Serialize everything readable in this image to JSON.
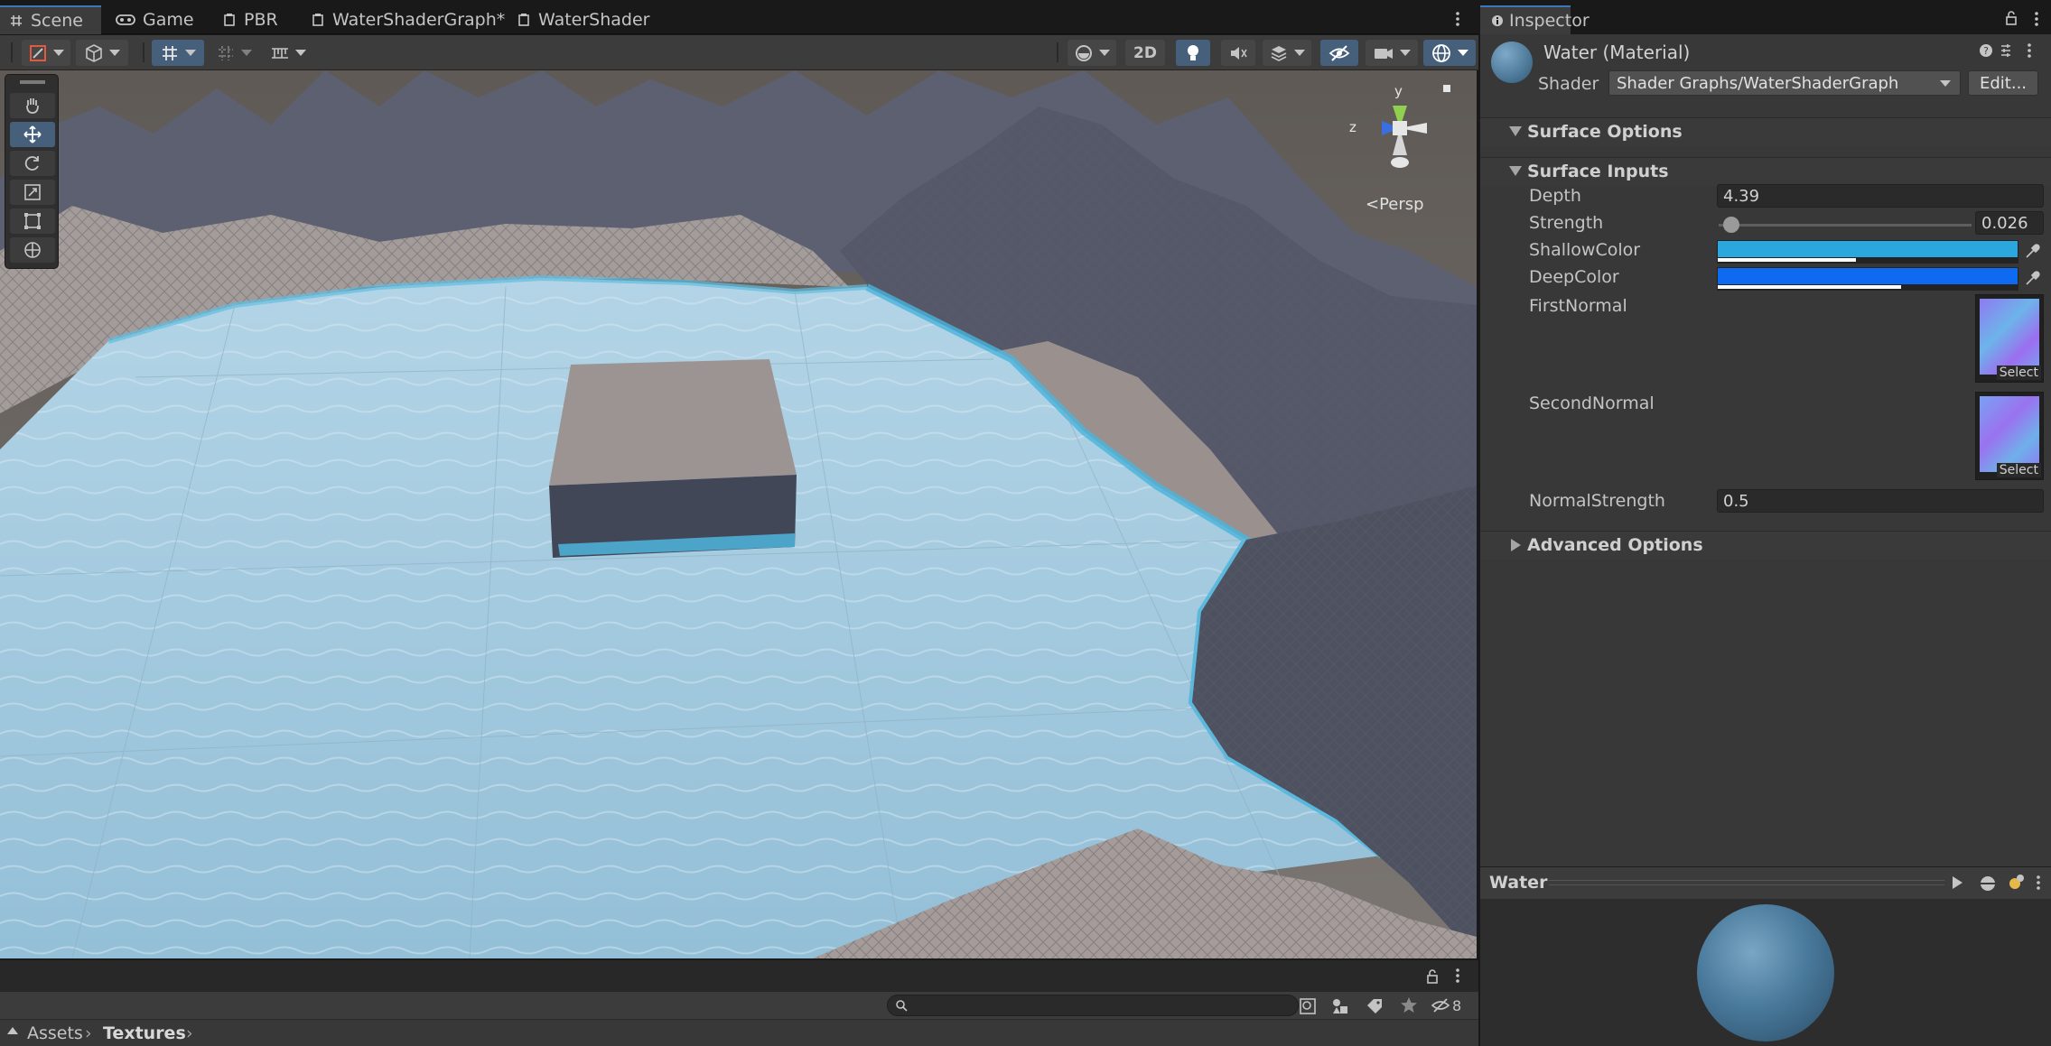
{
  "scene_tabs": [
    {
      "label": "Scene",
      "icon": "grid-icon",
      "active": true
    },
    {
      "label": "Game",
      "icon": "gamepad-icon",
      "active": false
    },
    {
      "label": "PBR",
      "icon": "shadergraph-icon",
      "active": false
    },
    {
      "label": "WaterShaderGraph*",
      "icon": "shadergraph-icon",
      "active": false
    },
    {
      "label": "WaterShader",
      "icon": "shadergraph-icon",
      "active": false
    }
  ],
  "scene_toolbar": {
    "btn_2d_label": "2D"
  },
  "viewport": {
    "view_mode_label": "Persp",
    "gizmo_y": "y",
    "gizmo_z": "z"
  },
  "inspector": {
    "tab_label": "Inspector",
    "material_title": "Water (Material)",
    "shader_label": "Shader",
    "shader_value": "Shader Graphs/WaterShaderGraph",
    "edit_label": "Edit...",
    "sections": {
      "surface_options": "Surface Options",
      "surface_inputs": "Surface Inputs",
      "advanced_options": "Advanced Options"
    },
    "properties": {
      "depth_label": "Depth",
      "depth_value": "4.39",
      "strength_label": "Strength",
      "strength_value": "0.026",
      "strength_fraction": 0.026,
      "shallow_label": "ShallowColor",
      "shallow_color": "#2ba7dd",
      "shallow_alpha_fraction": 0.46,
      "deep_label": "DeepColor",
      "deep_color": "#0d6af1",
      "deep_alpha_fraction": 0.61,
      "first_normal_label": "FirstNormal",
      "second_normal_label": "SecondNormal",
      "select_label": "Select",
      "normal_strength_label": "NormalStrength",
      "normal_strength_value": "0.5"
    }
  },
  "preview": {
    "title": "Water"
  },
  "project": {
    "breadcrumb_root": "Assets",
    "breadcrumb_current": "Textures",
    "hidden_count": "8",
    "search_placeholder": ""
  },
  "colors": {
    "accent": "#3a79bb",
    "water": "#9ec5dc",
    "terrain": "#6f6a66"
  }
}
